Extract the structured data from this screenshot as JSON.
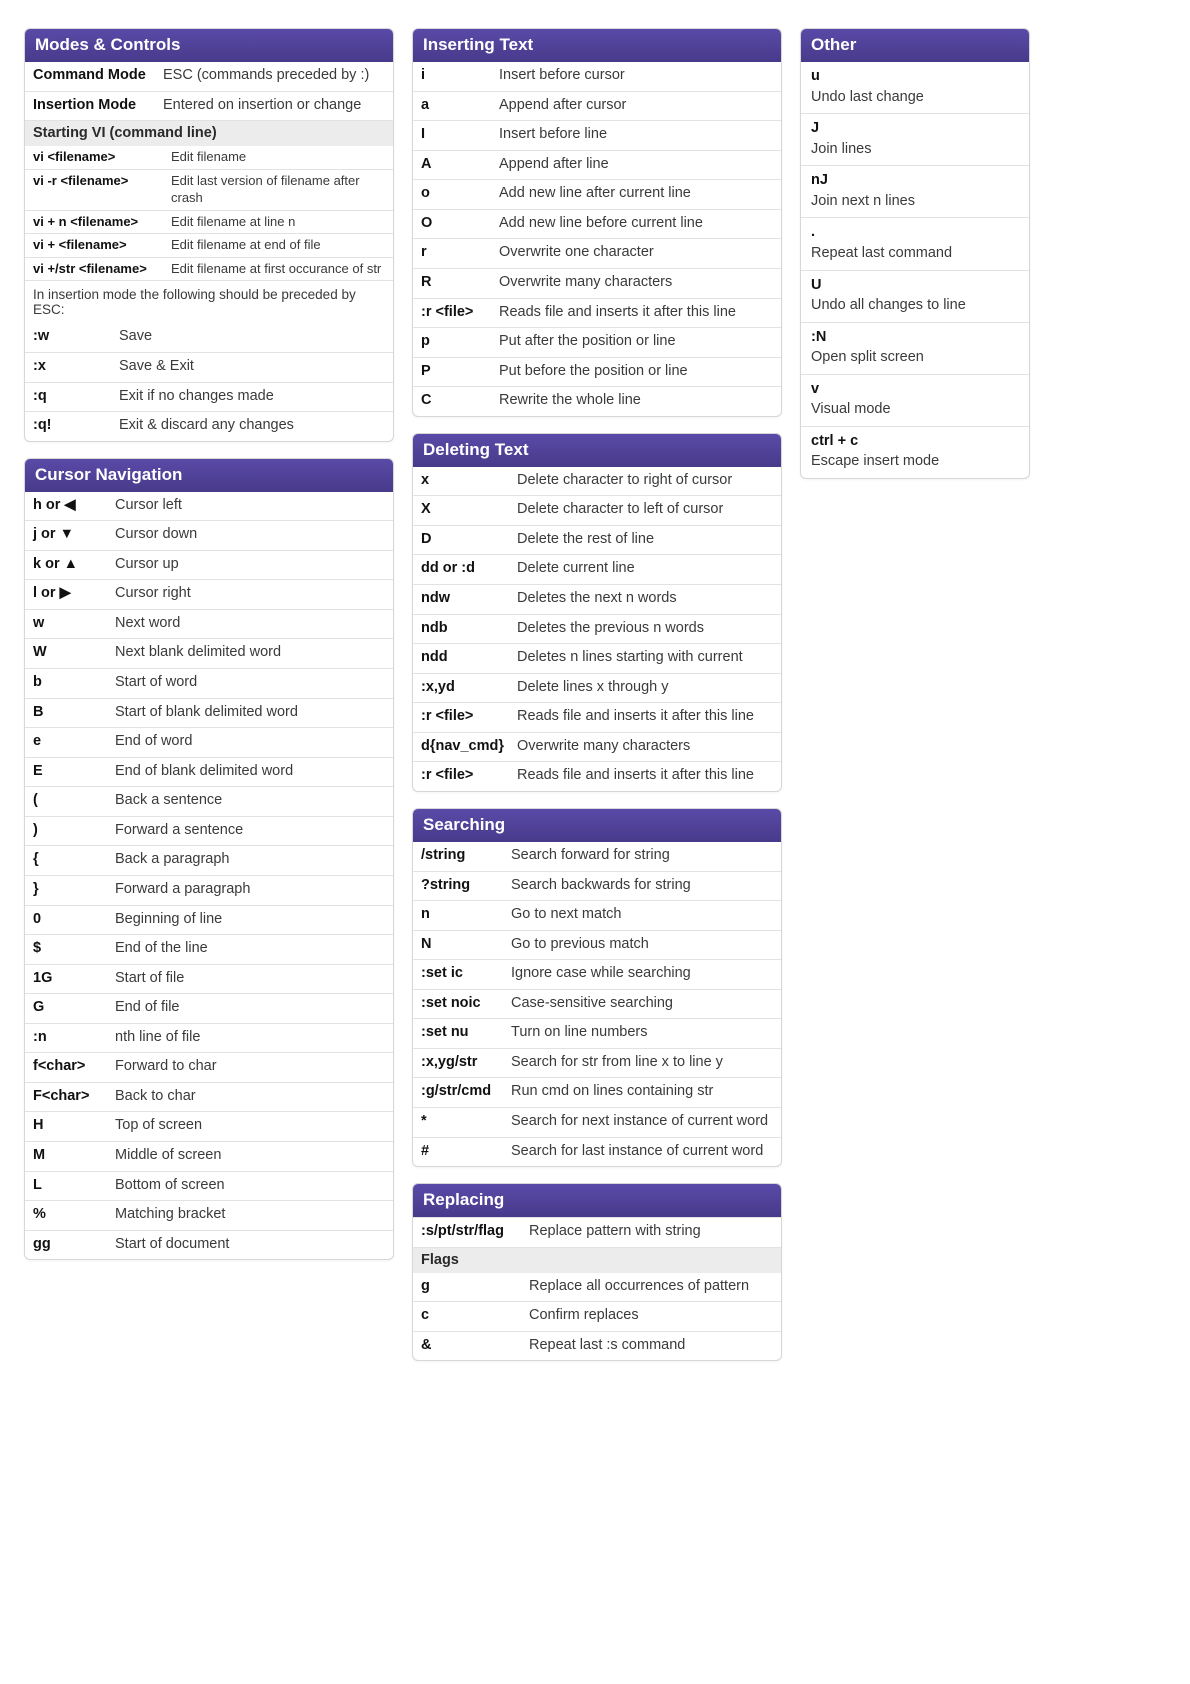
{
  "modes": {
    "title": "Modes & Controls",
    "rows": [
      {
        "k": "Command Mode",
        "v": "ESC (commands preceded by :)"
      },
      {
        "k": "Insertion Mode",
        "v": "Entered on insertion or change"
      }
    ],
    "startHeader": "Starting VI (command line)",
    "start": [
      {
        "k": "vi <filename>",
        "v": "Edit filename"
      },
      {
        "k": "vi -r <filename>",
        "v": "Edit last version of filename after crash"
      },
      {
        "k": "vi + n <filename>",
        "v": "Edit filename at line n"
      },
      {
        "k": "vi + <filename>",
        "v": "Edit filename at end of file"
      },
      {
        "k": "vi +/str <filename>",
        "v": "Edit filename at first occurance of str"
      }
    ],
    "escNote": "In insertion mode the following should be preceded by ESC:",
    "esc": [
      {
        "k": ":w",
        "v": "Save"
      },
      {
        "k": ":x",
        "v": "Save & Exit"
      },
      {
        "k": ":q",
        "v": "Exit if no changes made"
      },
      {
        "k": ":q!",
        "v": "Exit & discard any changes"
      }
    ]
  },
  "cursor": {
    "title": "Cursor Navigation",
    "rows": [
      {
        "k": "h or ◀",
        "v": "Cursor left"
      },
      {
        "k": "j or ▼",
        "v": "Cursor down"
      },
      {
        "k": "k or ▲",
        "v": "Cursor up"
      },
      {
        "k": "l or ▶",
        "v": "Cursor right"
      },
      {
        "k": "w",
        "v": "Next word"
      },
      {
        "k": "W",
        "v": "Next blank delimited word"
      },
      {
        "k": "b",
        "v": "Start of word"
      },
      {
        "k": "B",
        "v": "Start of blank delimited word"
      },
      {
        "k": "e",
        "v": "End of word"
      },
      {
        "k": "E",
        "v": "End of blank delimited word"
      },
      {
        "k": "(",
        "v": "Back a sentence"
      },
      {
        "k": ")",
        "v": "Forward a sentence"
      },
      {
        "k": "{",
        "v": "Back a paragraph"
      },
      {
        "k": "}",
        "v": "Forward a paragraph"
      },
      {
        "k": "0",
        "v": "Beginning of line"
      },
      {
        "k": "$",
        "v": "End of the line"
      },
      {
        "k": "1G",
        "v": "Start of file"
      },
      {
        "k": "G",
        "v": "End of file"
      },
      {
        "k": ":n",
        "v": "nth line of file"
      },
      {
        "k": "f<char>",
        "v": "Forward to char"
      },
      {
        "k": "F<char>",
        "v": "Back to char"
      },
      {
        "k": "H",
        "v": "Top of screen"
      },
      {
        "k": "M",
        "v": "Middle of screen"
      },
      {
        "k": "L",
        "v": "Bottom of screen"
      },
      {
        "k": "%",
        "v": "Matching bracket"
      },
      {
        "k": "gg",
        "v": "Start of document"
      }
    ]
  },
  "insert": {
    "title": "Inserting Text",
    "rows": [
      {
        "k": "i",
        "v": "Insert before cursor"
      },
      {
        "k": "a",
        "v": "Append after cursor"
      },
      {
        "k": "I",
        "v": "Insert before line"
      },
      {
        "k": "A",
        "v": "Append after line"
      },
      {
        "k": "o",
        "v": "Add new line after current line"
      },
      {
        "k": "O",
        "v": "Add new line before current line"
      },
      {
        "k": "r",
        "v": "Overwrite one character"
      },
      {
        "k": "R",
        "v": "Overwrite many characters"
      },
      {
        "k": ":r <file>",
        "v": "Reads file and inserts it after this line"
      },
      {
        "k": "p",
        "v": "Put after the position or line"
      },
      {
        "k": "P",
        "v": "Put before the position or line"
      },
      {
        "k": "C",
        "v": "Rewrite the whole line"
      }
    ]
  },
  "delete": {
    "title": "Deleting Text",
    "rows": [
      {
        "k": "x",
        "v": "Delete character to right of cursor"
      },
      {
        "k": "X",
        "v": "Delete character to left of cursor"
      },
      {
        "k": "D",
        "v": "Delete the rest of line"
      },
      {
        "k": "dd or :d",
        "v": "Delete current line"
      },
      {
        "k": "ndw",
        "v": "Deletes the next n words"
      },
      {
        "k": "ndb",
        "v": "Deletes the previous n words"
      },
      {
        "k": "ndd",
        "v": "Deletes n lines starting with current"
      },
      {
        "k": ":x,yd",
        "v": "Delete lines x through y"
      },
      {
        "k": ":r <file>",
        "v": "Reads file and inserts it after this line"
      },
      {
        "k": "d{nav_cmd}",
        "v": "Overwrite many characters"
      },
      {
        "k": ":r <file>",
        "v": "Reads file and inserts it after this line"
      }
    ]
  },
  "search": {
    "title": "Searching",
    "rows": [
      {
        "k": "/string",
        "v": "Search forward for string"
      },
      {
        "k": "?string",
        "v": "Search backwards for string"
      },
      {
        "k": "n",
        "v": "Go to next match"
      },
      {
        "k": "N",
        "v": "Go to previous match"
      },
      {
        "k": ":set ic",
        "v": "Ignore case while searching"
      },
      {
        "k": ":set noic",
        "v": "Case-sensitive searching"
      },
      {
        "k": ":set nu",
        "v": "Turn on line numbers"
      },
      {
        "k": ":x,yg/str",
        "v": "Search for str from line x to line y"
      },
      {
        "k": ":g/str/cmd",
        "v": "Run cmd on lines containing str"
      },
      {
        "k": "*",
        "v": "Search for next instance of current word"
      },
      {
        "k": "#",
        "v": "Search for last instance of current word"
      }
    ]
  },
  "replace": {
    "title": "Replacing",
    "row0": {
      "k": ":s/pt/str/flag",
      "v": "Replace pattern with string"
    },
    "flagsHeader": "Flags",
    "flags": [
      {
        "k": "g",
        "v": "Replace all occurrences of pattern"
      },
      {
        "k": "c",
        "v": "Confirm replaces"
      },
      {
        "k": "&",
        "v": "Repeat last :s command"
      }
    ]
  },
  "other": {
    "title": "Other",
    "rows": [
      {
        "k": "u",
        "v": "Undo last change"
      },
      {
        "k": "J",
        "v": "Join lines"
      },
      {
        "k": "nJ",
        "v": "Join next n lines"
      },
      {
        "k": ".",
        "v": "Repeat last command"
      },
      {
        "k": "U",
        "v": "Undo all changes to line"
      },
      {
        "k": ":N",
        "v": "Open split screen"
      },
      {
        "k": "v",
        "v": "Visual mode"
      },
      {
        "k": "ctrl + c",
        "v": "Escape insert mode"
      }
    ]
  }
}
